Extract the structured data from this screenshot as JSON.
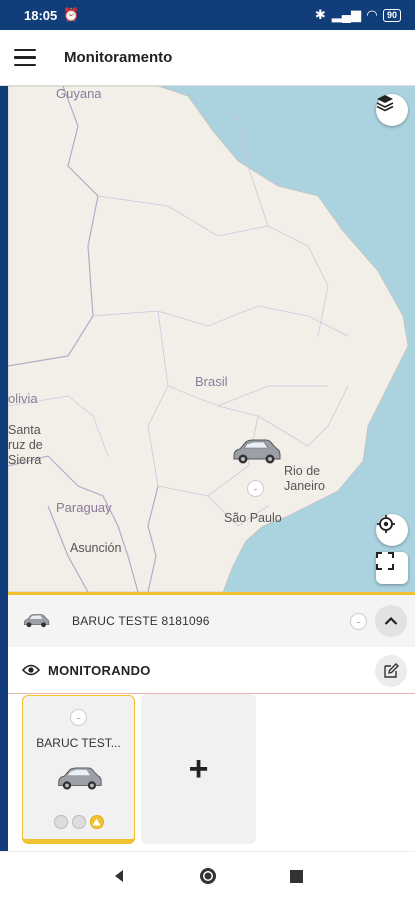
{
  "status_bar": {
    "time": "18:05",
    "battery": "90"
  },
  "app_bar": {
    "title": "Monitoramento"
  },
  "map": {
    "labels": {
      "guyana": "Guyana",
      "brasil": "Brasil",
      "bolivia": "olivia",
      "santa_cruz": "Santa\nruz de\nSierra",
      "paraguay": "Paraguay",
      "asuncion": "Asunción",
      "rio": "Rio de\nJaneiro",
      "sao_paulo": "São Paulo"
    },
    "marker_badge": "-"
  },
  "selected_vehicle": {
    "name": "BARUC TESTE 8181096",
    "badge": "-"
  },
  "monitoring": {
    "title": "MONITORANDO",
    "cards": [
      {
        "name": "BARUC TEST...",
        "badge": "-"
      }
    ],
    "add_label": "+"
  },
  "colors": {
    "brand_blue": "#113e7a",
    "accent_yellow": "#f2c230",
    "water": "#aad3df",
    "land": "#f2efe9"
  }
}
